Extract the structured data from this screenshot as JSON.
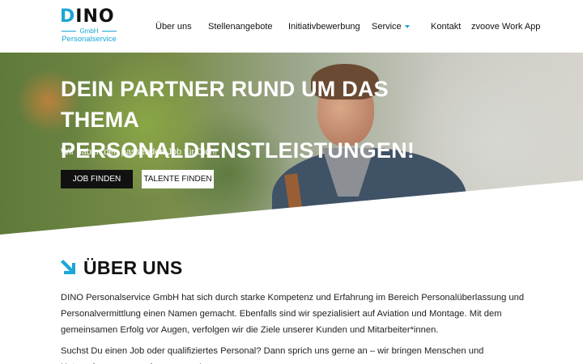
{
  "brand": {
    "name": "DINO",
    "gmbh": "GmbH",
    "sub": "Personalservice",
    "accent": "#1aa6d6"
  },
  "nav": {
    "items": [
      {
        "label": "Über uns"
      },
      {
        "label": "Stellenangebote"
      },
      {
        "label": "Initiativbewerbung"
      },
      {
        "label": "Service"
      },
      {
        "label": "Kontakt"
      },
      {
        "label": "zvoove Work App"
      }
    ]
  },
  "hero": {
    "title": "Dein Partner rund um das Thema Personaldienstleistungen!",
    "subtitle": "Wir haben den passenden Job für Dich!",
    "primary_button": "Job finden",
    "secondary_button": "Talente finden"
  },
  "about": {
    "title": "Über uns",
    "paragraph1": "DINO Personalservice GmbH hat sich durch starke Kompetenz und Erfahrung im Bereich Personalüberlassung und Personalvermittlung einen Namen gemacht. Ebenfalls sind wir spezialisiert auf Aviation und Montage. Mit dem gemeinsamen Erfolg vor Augen, verfolgen wir die Ziele unserer Kunden und Mitarbeiter*innen.",
    "paragraph2": "Suchst Du einen Job oder qualifiziertes Personal? Dann sprich uns gerne an – wir bringen Menschen und Unternehmen passend zusammen!"
  },
  "icons": {
    "logo": "dino-logo",
    "service_caret": "chevron-down-icon",
    "section_arrow": "arrow-down-right-icon"
  }
}
